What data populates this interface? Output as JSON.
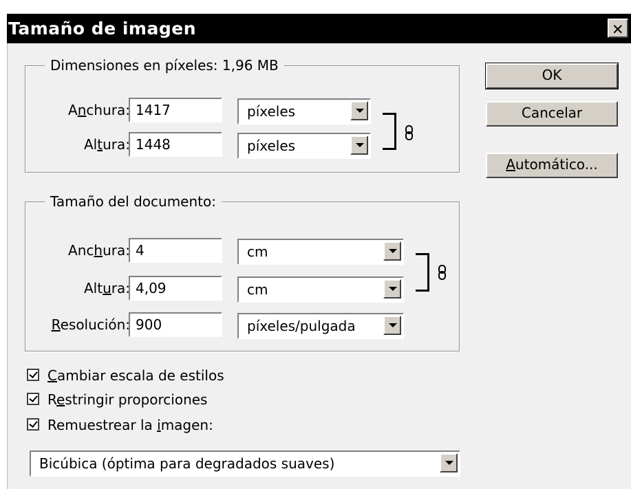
{
  "dialog": {
    "title": "Tamaño de imagen",
    "close_label": "✕"
  },
  "pixel_dimensions": {
    "legend": "Dimensiones en píxeles: 1,96 MB",
    "width": {
      "label_pre": "A",
      "label_ul": "n",
      "label_post": "chura:",
      "value": "1417",
      "unit": "píxeles"
    },
    "height": {
      "label_pre": "Al",
      "label_ul": "t",
      "label_post": "ura:",
      "value": "1448",
      "unit": "píxeles"
    }
  },
  "document_size": {
    "legend": "Tamaño del documento:",
    "width": {
      "label_pre": "Anc",
      "label_ul": "h",
      "label_post": "ura:",
      "value": "4",
      "unit": "cm"
    },
    "height": {
      "label_pre": "Alt",
      "label_ul": "u",
      "label_post": "ra:",
      "value": "4,09",
      "unit": "cm"
    },
    "resolution": {
      "label_pre": "",
      "label_ul": "R",
      "label_post": "esolución:",
      "value": "900",
      "unit": "píxeles/pulgada"
    }
  },
  "buttons": {
    "ok": "OK",
    "cancel": "Cancelar",
    "auto_ul": "A",
    "auto_rest": "utomático..."
  },
  "options": {
    "scale_styles": {
      "ul": "C",
      "rest": "ambiar escala de estilos",
      "checked": true
    },
    "constrain": {
      "pre": "R",
      "ul": "e",
      "rest": "stringir proporciones",
      "checked": true
    },
    "resample": {
      "pre": "Remuestrear la ",
      "ul": "i",
      "rest": "magen:",
      "checked": true
    }
  },
  "resample_method": "Bicúbica (óptima para degradados suaves)",
  "icons": {
    "chain": "chain-link-icon",
    "dropdown": "chevron-down-icon",
    "close": "close-icon"
  }
}
